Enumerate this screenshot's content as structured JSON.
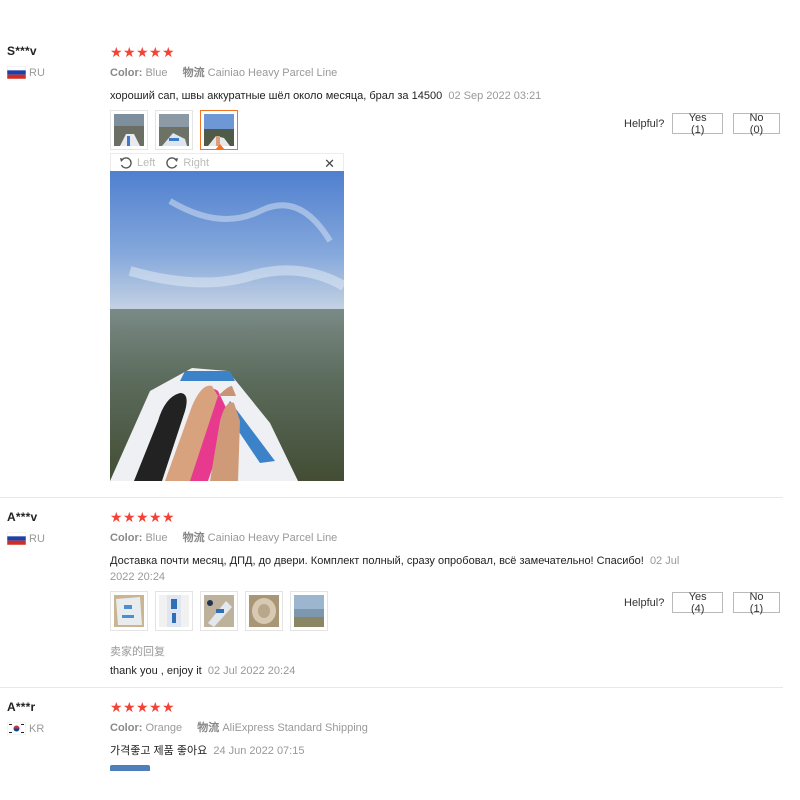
{
  "reviews": [
    {
      "user": "S***v",
      "country": "RU",
      "color_label": "Color:",
      "color_value": "Blue",
      "shipping_label": "物流",
      "shipping_value": "Cainiao Heavy Parcel Line",
      "text": "хороший сап, швы аккуратные шёл около месяца, брал за 14500",
      "date": "02 Sep 2022 03:21",
      "helpful_label": "Helpful?",
      "yes": "Yes (1)",
      "no": "No (0)",
      "viewer": {
        "left": "Left",
        "right": "Right",
        "close": "✕"
      }
    },
    {
      "user": "A***v",
      "country": "RU",
      "color_label": "Color:",
      "color_value": "Blue",
      "shipping_label": "物流",
      "shipping_value": "Cainiao Heavy Parcel Line",
      "text": "Доставка почти месяц, ДПД, до двери. Комплект полный, сразу опробовал, всё замечательно! Спасибо!",
      "date": "02 Jul 2022 20:24",
      "helpful_label": "Helpful?",
      "yes": "Yes (4)",
      "no": "No (1)",
      "reply_label": "卖家的回复",
      "reply_text": "thank you , enjoy it",
      "reply_date": "02 Jul 2022 20:24"
    },
    {
      "user": "A***r",
      "country": "KR",
      "color_label": "Color:",
      "color_value": "Orange",
      "shipping_label": "物流",
      "shipping_value": "AliExpress Standard Shipping",
      "text": "가격좋고 제품 좋아요",
      "date": "24 Jun 2022 07:15"
    }
  ],
  "colors": {
    "star": "#f44336",
    "active_thumb": "#f57224",
    "divider": "#e8e8e8"
  },
  "star_rating": 5
}
